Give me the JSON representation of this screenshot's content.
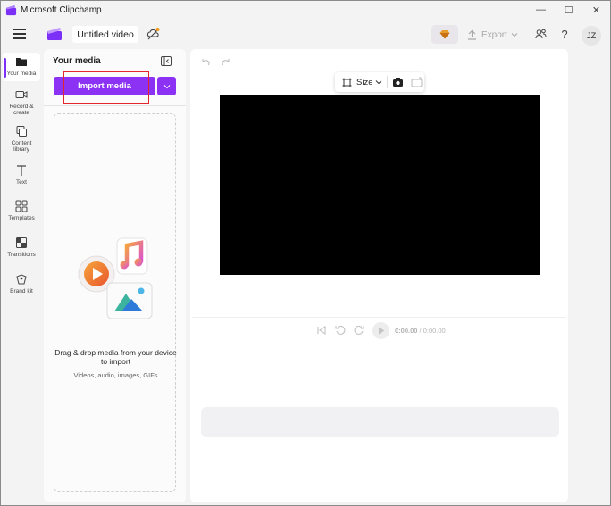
{
  "window": {
    "title": "Microsoft Clipchamp",
    "controls": {
      "minimize": "—",
      "maximize": "☐",
      "close": "✕"
    }
  },
  "header": {
    "project_title": "Untitled video",
    "export_label": "Export",
    "help_label": "?",
    "avatar_initials": "JZ"
  },
  "sidebar": {
    "items": [
      {
        "label": "Your media",
        "icon": "folder-icon",
        "active": true
      },
      {
        "label": "Record & create",
        "icon": "camera-icon",
        "active": false
      },
      {
        "label": "Content library",
        "icon": "library-icon",
        "active": false
      },
      {
        "label": "Text",
        "icon": "text-icon",
        "active": false
      },
      {
        "label": "Templates",
        "icon": "templates-icon",
        "active": false
      },
      {
        "label": "Transitions",
        "icon": "transitions-icon",
        "active": false
      },
      {
        "label": "Brand kit",
        "icon": "brand-kit-icon",
        "active": false
      }
    ]
  },
  "media_panel": {
    "title": "Your media",
    "import_button": "Import media",
    "drop_title": "Drag & drop media from your device to import",
    "drop_subtitle": "Videos, audio, images, GIFs"
  },
  "editor": {
    "size_label": "Size",
    "time_current": "0:00.00",
    "time_total": "/ 0:00.00"
  },
  "colors": {
    "accent": "#8b32f5",
    "highlight": "#e3262b",
    "canvas": "#000000"
  }
}
